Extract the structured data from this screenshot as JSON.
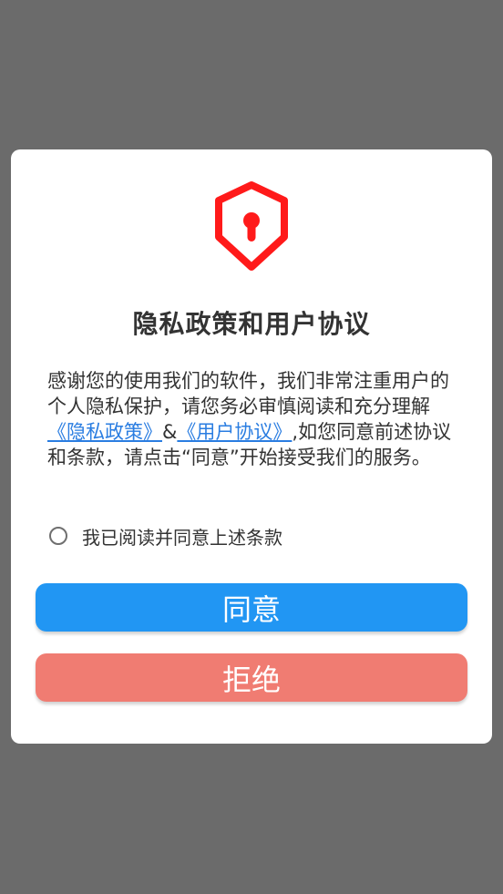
{
  "colors": {
    "overlay": "#6b6b6b",
    "dialog_bg": "#ffffff",
    "shield_red": "#ff1a1a",
    "link": "#2a7de1",
    "agree_button": "#2196f3",
    "decline_button": "#f07c72"
  },
  "dialog": {
    "icon": "shield-lock-icon",
    "title": "隐私政策和用户协议",
    "body": {
      "part1": "感谢您的使用我们的软件，我们非常注重用户的个人隐私保护，请您务必审慎阅读和充分理解",
      "privacy_link": "《隐私政策》",
      "ampersand": "&",
      "user_agreement_link": "《用户协议》",
      "part2": ",如您同意前述协议和条款，请点击“同意”开始接受我们的服务。"
    },
    "agree_checkbox_label": "我已阅读并同意上述条款",
    "agree_button_label": "同意",
    "decline_button_label": "拒绝"
  }
}
